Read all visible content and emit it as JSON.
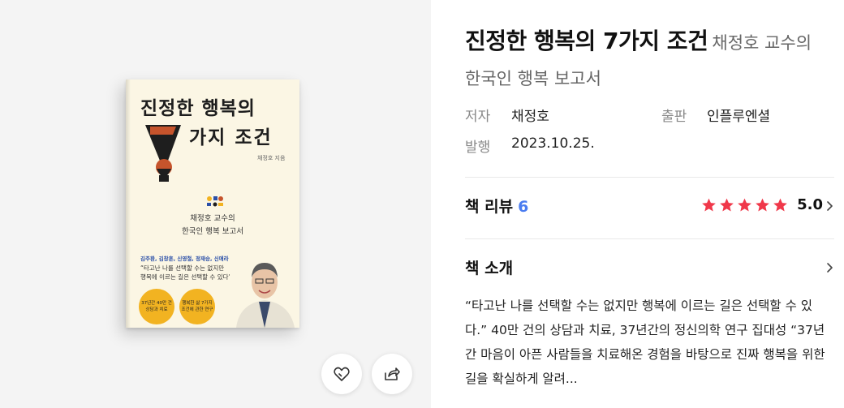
{
  "book": {
    "title": "진정한 행복의 7가지 조건",
    "subtitle": "채정호 교수의 한국인 행복 보고서"
  },
  "cover": {
    "title_line1": "진정한 행복의",
    "title_line2": "가지 조건",
    "author_small": "채정호 지음",
    "sub_line1": "채정호 교수의",
    "sub_line2": "한국인 행복 보고서",
    "recommenders": "김주환, 김창훈, 신영철, 정재승, 신애라 추천",
    "quote_line1": "“타고난 나를 선택할 수는 없지만",
    "quote_line2": "행복에 이르는 길은 선택할 수 있다”",
    "badge1": "37년간\n40만 건\n상담과 치료",
    "badge2": "행복한 삶\n7가지 조건에\n관한 연구"
  },
  "meta": {
    "author_label": "저자",
    "author": "채정호",
    "publisher_label": "출판",
    "publisher": "인플루엔셜",
    "date_label": "발행",
    "date": "2023.10.25."
  },
  "review": {
    "label": "책 리뷰",
    "count": "6",
    "rating": "5.0",
    "stars": 5,
    "star_color": "#f0384a"
  },
  "intro": {
    "label": "책 소개",
    "text": "“타고난 나를 선택할 수는 없지만 행복에 이르는 길은 선택할 수 있다.” 40만 건의 상담과 치료, 37년간의 정신의학 연구 집대성 “37년간 마음이 아픈 사람들을 치료해온 경험을 바탕으로 진짜 행복을 위한 길을 확실하게 알려..."
  },
  "icons": {
    "like": "heart-icon",
    "share": "share-icon"
  }
}
